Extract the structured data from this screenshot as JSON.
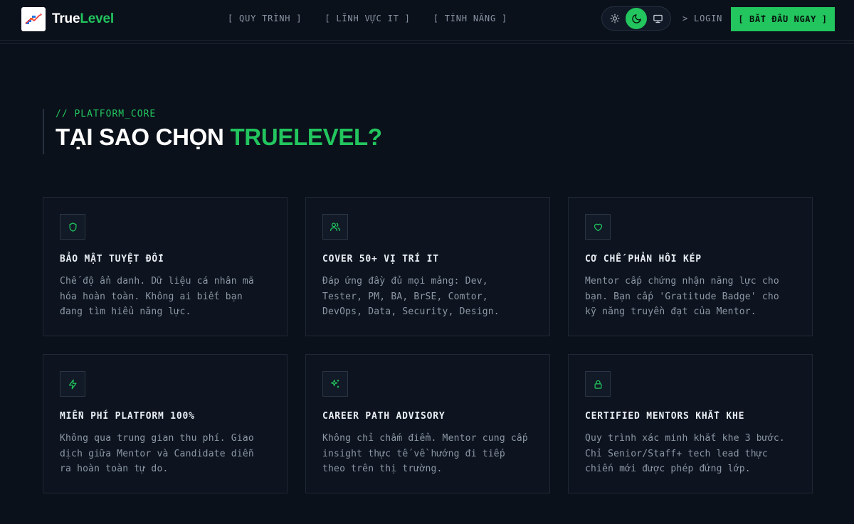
{
  "brand": {
    "name_part1": "True",
    "name_part2": "Level",
    "logo_icon": "trending-chart-logo"
  },
  "nav": {
    "menu": [
      {
        "label": "[ QUY TRÌNH ]"
      },
      {
        "label": "[ LĨNH VỰC IT ]"
      },
      {
        "label": "[ TÍNH NĂNG ]"
      }
    ],
    "theme": {
      "options": [
        "sun-icon",
        "moon-icon",
        "monitor-icon"
      ],
      "selected": "dark"
    },
    "login_label": "> LOGIN",
    "cta_label": "[ BẮT ĐẦU NGAY ]"
  },
  "section": {
    "eyebrow": "// PLATFORM_CORE",
    "title_prefix": "TẠI SAO CHỌN ",
    "title_highlight": "TRUELEVEL?"
  },
  "features": [
    {
      "icon": "shield-icon",
      "title": "BẢO MẬT TUYỆT ĐỐI",
      "desc": "Chế độ ẩn danh. Dữ liệu cá nhân mã hóa hoàn toàn. Không ai biết bạn đang tìm hiểu năng lực."
    },
    {
      "icon": "users-icon",
      "title": "COVER 50+ VỊ TRÍ IT",
      "desc": "Đáp ứng đầy đủ mọi mảng: Dev, Tester, PM, BA, BrSE, Comtor, DevOps, Data, Security, Design."
    },
    {
      "icon": "heart-icon",
      "title": "CƠ CHẾ PHẢN HỒI KÉP",
      "desc": "Mentor cấp chứng nhận năng lực cho bạn. Bạn cấp 'Gratitude Badge' cho kỹ năng truyền đạt của Mentor."
    },
    {
      "icon": "lightning-icon",
      "title": "MIỄN PHÍ PLATFORM 100%",
      "desc": "Không qua trung gian thu phí. Giao dịch giữa Mentor và Candidate diễn ra hoàn toàn tự do."
    },
    {
      "icon": "sparkles-icon",
      "title": "CAREER PATH ADVISORY",
      "desc": "Không chỉ chấm điểm. Mentor cung cấp insight thực tế về hướng đi tiếp theo trên thị trường."
    },
    {
      "icon": "lock-icon",
      "title": "CERTIFIED MENTORS KHẮT KHE",
      "desc": "Quy trình xác minh khắt khe 3 bước. Chỉ Senior/Staff+ tech lead thực chiến mới được phép đứng lớp."
    }
  ],
  "colors": {
    "accent": "#22c55e",
    "background": "#0b111b",
    "card_bg": "#0d141f",
    "border": "#1e2836"
  }
}
